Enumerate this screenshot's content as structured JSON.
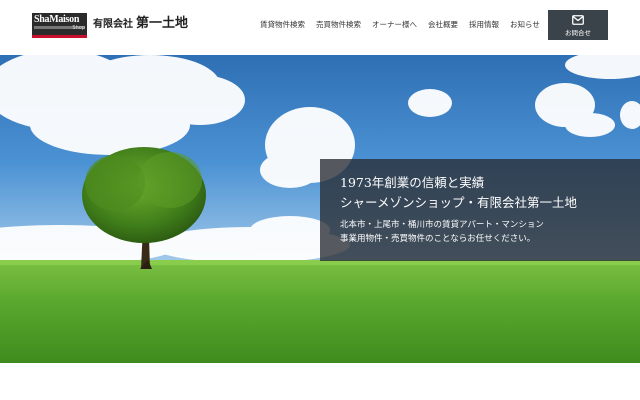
{
  "header": {
    "logo": {
      "text": "ShaMaison",
      "sub": "Shop"
    },
    "company_prefix": "有限会社",
    "company_name": "第一土地",
    "nav": [
      {
        "label": "賃貸物件検索"
      },
      {
        "label": "売買物件検索"
      },
      {
        "label": "オーナー様へ"
      },
      {
        "label": "会社概要"
      },
      {
        "label": "採用情報"
      },
      {
        "label": "お知らせ"
      }
    ],
    "contact": {
      "label": "お問合せ",
      "icon": "mail-icon"
    }
  },
  "hero": {
    "headline_line1": "1973年創業の信頼と実績",
    "headline_line2": "シャーメゾンショップ・有限会社第一土地",
    "sub_line1": "北本市・上尾市・桶川市の賃貸アパート・マンション",
    "sub_line2": "事業用物件・売買物件のことならお任せください。"
  },
  "colors": {
    "logo_bg": "#2b2b2b",
    "logo_accent": "#c8102e",
    "contact_bg": "#3a424a",
    "sky": "#3b82c8",
    "grass": "#5aa82e"
  }
}
